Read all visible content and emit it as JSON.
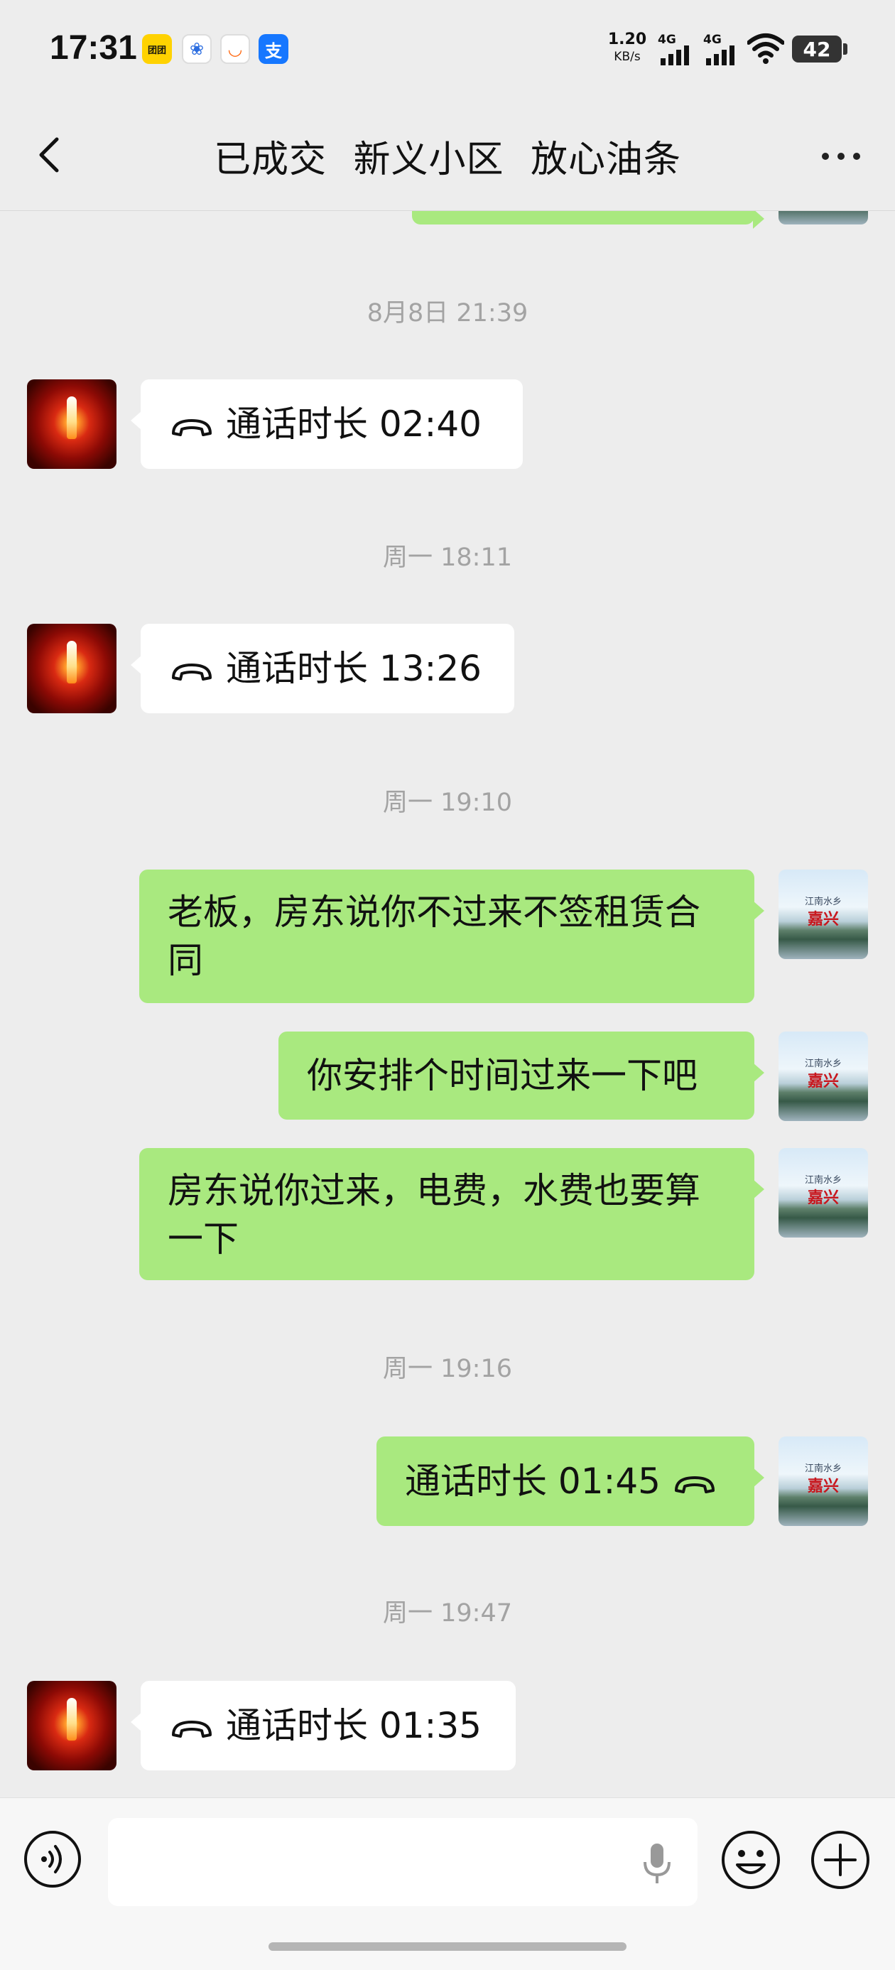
{
  "status_bar": {
    "time": "17:31",
    "app_icons": [
      "meituan-icon",
      "baidu-icon",
      "didi-icon",
      "alipay-icon"
    ],
    "net_speed_value": "1.20",
    "net_speed_unit": "KB/s",
    "signal_1": "4G",
    "signal_2": "4G",
    "battery": "42"
  },
  "nav": {
    "title": "已成交  新义小区  放心油条"
  },
  "messages": [
    {
      "type": "timestamp",
      "text": "8月8日 21:39"
    },
    {
      "type": "call",
      "side": "left",
      "label": "通话时长 02:40"
    },
    {
      "type": "timestamp",
      "text": "周一 18:11"
    },
    {
      "type": "call",
      "side": "left",
      "label": "通话时长 13:26"
    },
    {
      "type": "timestamp",
      "text": "周一 19:10"
    },
    {
      "type": "text",
      "side": "right",
      "text": "老板，房东说你不过来不签租赁合同"
    },
    {
      "type": "text",
      "side": "right",
      "text": "你安排个时间过来一下吧"
    },
    {
      "type": "text",
      "side": "right",
      "text": "房东说你过来，电费，水费也要算一下"
    },
    {
      "type": "timestamp",
      "text": "周一 19:16"
    },
    {
      "type": "call",
      "side": "right",
      "label": "通话时长 01:45"
    },
    {
      "type": "timestamp",
      "text": "周一 19:47"
    },
    {
      "type": "call",
      "side": "left",
      "label": "通话时长 01:35"
    }
  ],
  "avatars": {
    "contact": "candle-avatar",
    "self_line1": "江南水乡",
    "self_line2": "嘉兴"
  },
  "input": {
    "placeholder": "",
    "value": ""
  },
  "colors": {
    "background": "#ededed",
    "outgoing_bubble": "#a9e97f",
    "incoming_bubble": "#ffffff",
    "timestamp": "#a3a3a3"
  }
}
